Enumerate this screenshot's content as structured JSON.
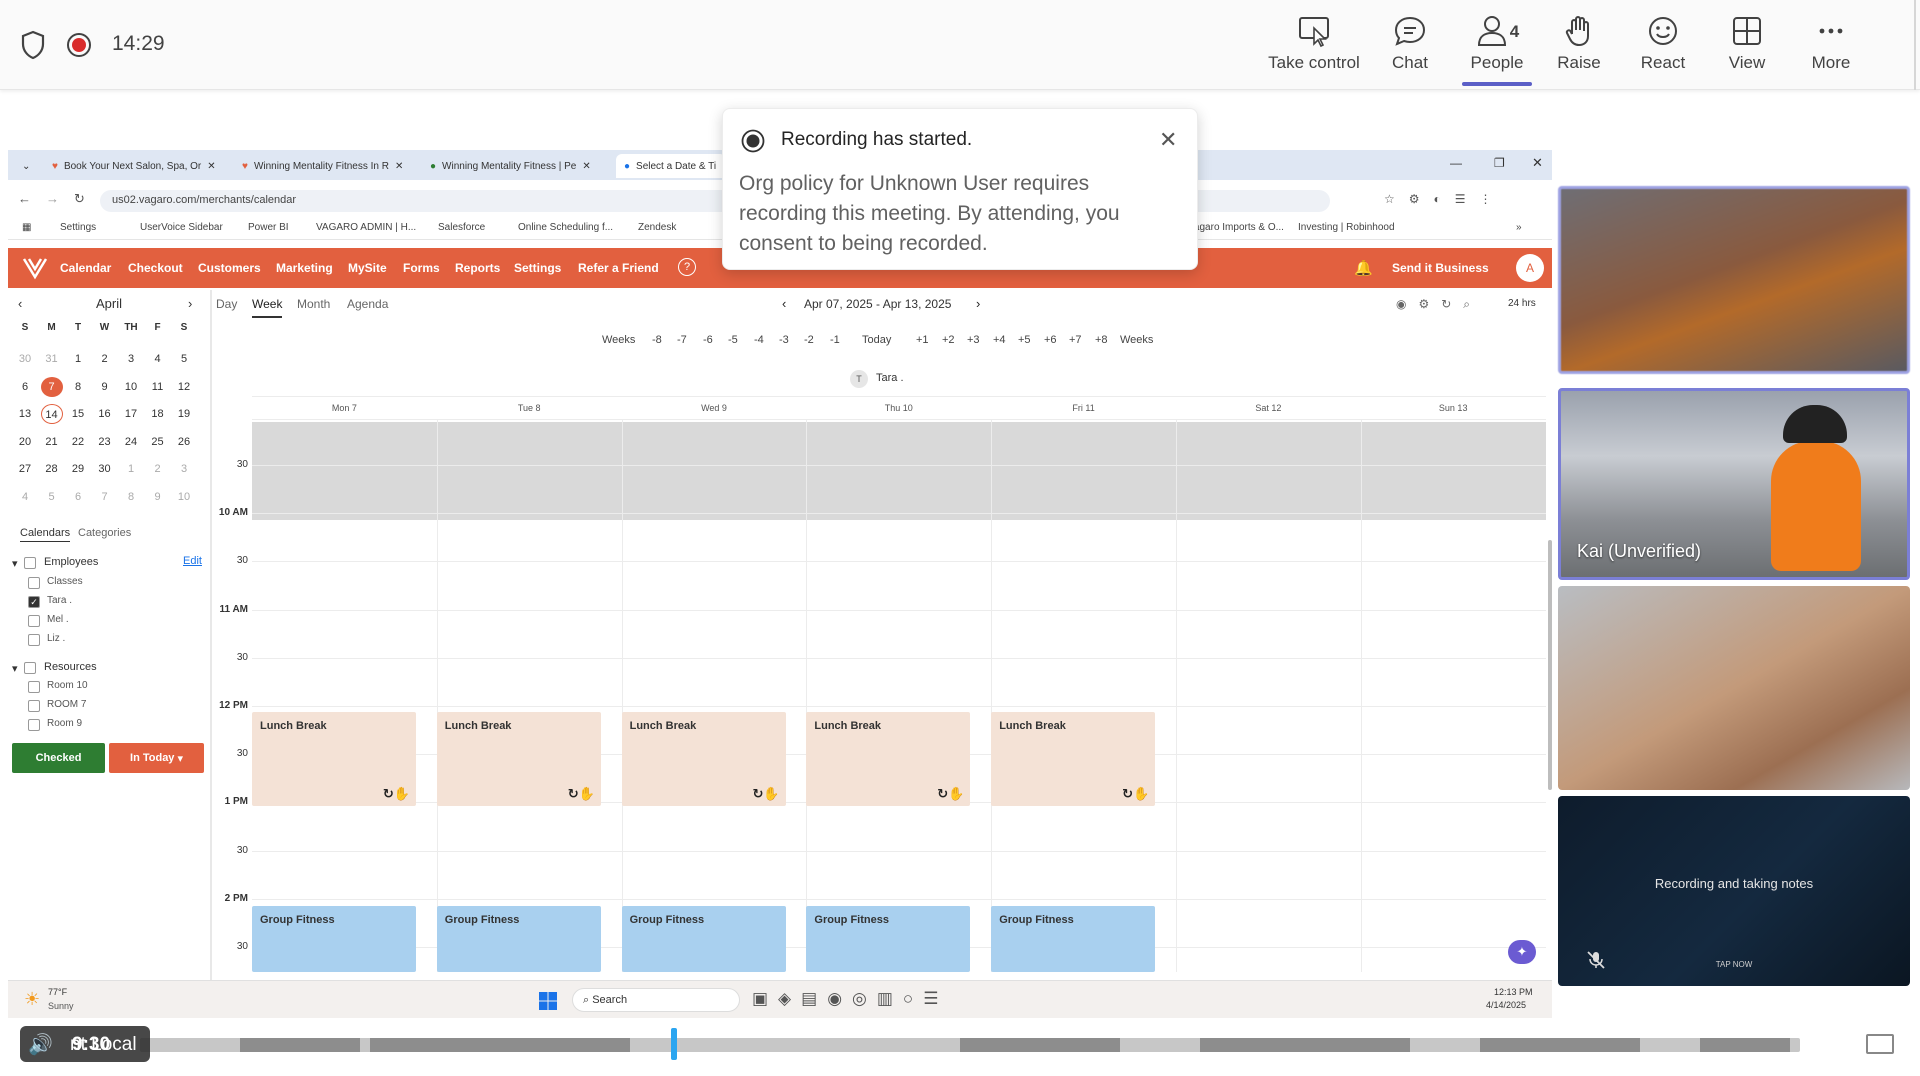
{
  "meeting": {
    "time": "14:29",
    "toolbar": [
      {
        "label": "Take control",
        "icon": "take-control-icon"
      },
      {
        "label": "Chat",
        "icon": "chat-icon"
      },
      {
        "label": "People",
        "icon": "people-icon",
        "count": "4"
      },
      {
        "label": "Raise",
        "icon": "raise-hand-icon"
      },
      {
        "label": "React",
        "icon": "react-icon"
      },
      {
        "label": "View",
        "icon": "view-icon"
      },
      {
        "label": "More",
        "icon": "more-icon"
      }
    ]
  },
  "notification": {
    "title": "Recording has started.",
    "body": "Org policy for Unknown User requires recording this meeting. By attending, you consent to being recorded."
  },
  "browser": {
    "tabs": [
      "Book Your Next Salon, Spa, Or",
      "Winning Mentality Fitness In R",
      "Winning Mentality Fitness | Pe",
      "Select a Date & Ti"
    ],
    "url": "us02.vagaro.com/merchants/calendar",
    "bookmarks": [
      "Settings",
      "UserVoice Sidebar",
      "Power BI",
      "VAGARO ADMIN | H...",
      "Salesforce",
      "Online Scheduling f...",
      "Zendesk",
      "Vagaro Imports & O...",
      "Investing | Robinhood"
    ]
  },
  "vagaro": {
    "nav": [
      "Calendar",
      "Checkout",
      "Customers",
      "Marketing",
      "MySite",
      "Forms",
      "Reports",
      "Settings",
      "Refer a Friend"
    ],
    "send_business": "Send it Business",
    "avatar": "A",
    "view_tabs": [
      "Day",
      "Week",
      "Month",
      "Agenda"
    ],
    "date_range": "Apr 07, 2025 - Apr 13, 2025",
    "week_nav": [
      "Weeks",
      "-8",
      "-7",
      "-6",
      "-5",
      "-4",
      "-3",
      "-2",
      "-1",
      "Today",
      "+1",
      "+2",
      "+3",
      "+4",
      "+5",
      "+6",
      "+7",
      "+8",
      "Weeks"
    ],
    "hours_toggle": "24 hrs",
    "employee_chip": "Tara .",
    "days": [
      "Mon 7",
      "Tue 8",
      "Wed 9",
      "Thu 10",
      "Fri 11",
      "Sat 12",
      "Sun 13"
    ],
    "times": [
      "30",
      "10 AM",
      "30",
      "11 AM",
      "30",
      "12 PM",
      "30",
      "1 PM",
      "30",
      "2 PM",
      "30"
    ],
    "lunch_label": "Lunch Break",
    "fitness_label": "Group Fitness",
    "mini_month": "April",
    "mini_days_header": [
      "S",
      "M",
      "T",
      "W",
      "TH",
      "F",
      "S"
    ],
    "mini_weeks": [
      [
        "30",
        "31",
        "1",
        "2",
        "3",
        "4",
        "5"
      ],
      [
        "6",
        "7",
        "8",
        "9",
        "10",
        "11",
        "12"
      ],
      [
        "13",
        "14",
        "15",
        "16",
        "17",
        "18",
        "19"
      ],
      [
        "20",
        "21",
        "22",
        "23",
        "24",
        "25",
        "26"
      ],
      [
        "27",
        "28",
        "29",
        "30",
        "1",
        "2",
        "3"
      ],
      [
        "4",
        "5",
        "6",
        "7",
        "8",
        "9",
        "10"
      ]
    ],
    "side_tabs": [
      "Calendars",
      "Categories"
    ],
    "edit": "Edit",
    "employees_label": "Employees",
    "employees": [
      {
        "name": "Classes",
        "checked": false
      },
      {
        "name": "Tara .",
        "checked": true
      },
      {
        "name": "Mel .",
        "checked": false
      },
      {
        "name": "Liz .",
        "checked": false
      }
    ],
    "resources_label": "Resources",
    "resources": [
      "Room 10",
      "ROOM 7",
      "Room 9"
    ],
    "checked_btn": "Checked",
    "in_today_btn": "In Today"
  },
  "taskbar": {
    "weather_temp": "77°F",
    "weather_desc": "Sunny",
    "search": "Search",
    "clock_time": "12:13 PM",
    "clock_date": "4/14/2025"
  },
  "participants": {
    "kai_label": "Kai (Unverified)",
    "notes_text": "Recording and taking notes",
    "notes_sub": "TAP NOW"
  },
  "player": {
    "time": "9:30",
    "overlay_text": "nt Local",
    "progress_fraction": 0.32
  }
}
